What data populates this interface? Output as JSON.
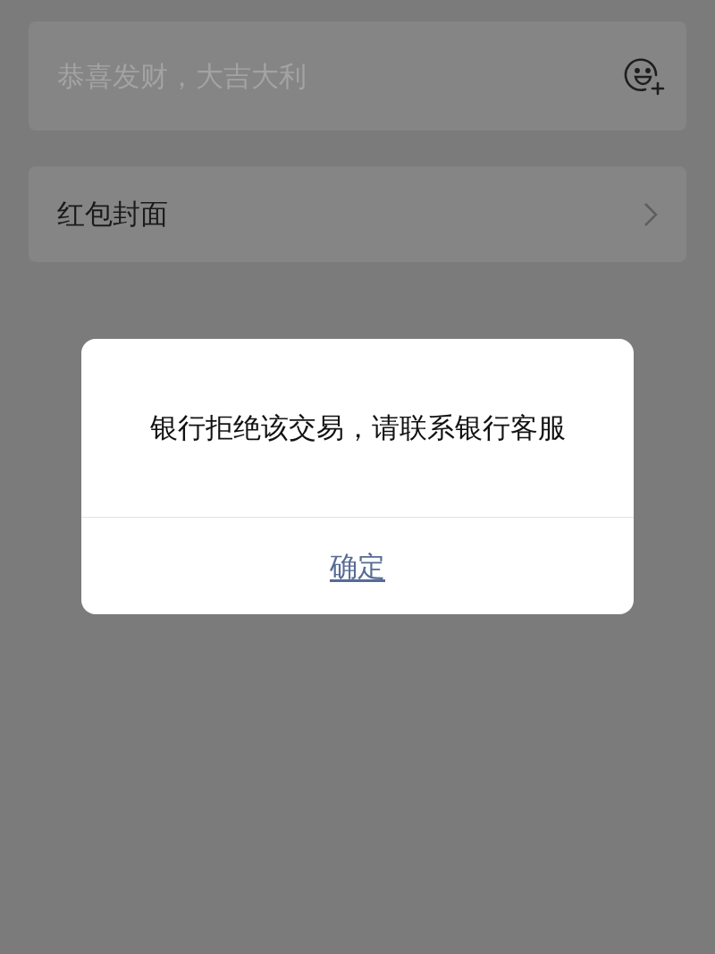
{
  "greeting_field": {
    "placeholder": "恭喜发财，大吉大利"
  },
  "cover_row": {
    "label": "红包封面"
  },
  "dialog": {
    "message": "银行拒绝该交易，请联系银行客服",
    "button": "确定"
  }
}
